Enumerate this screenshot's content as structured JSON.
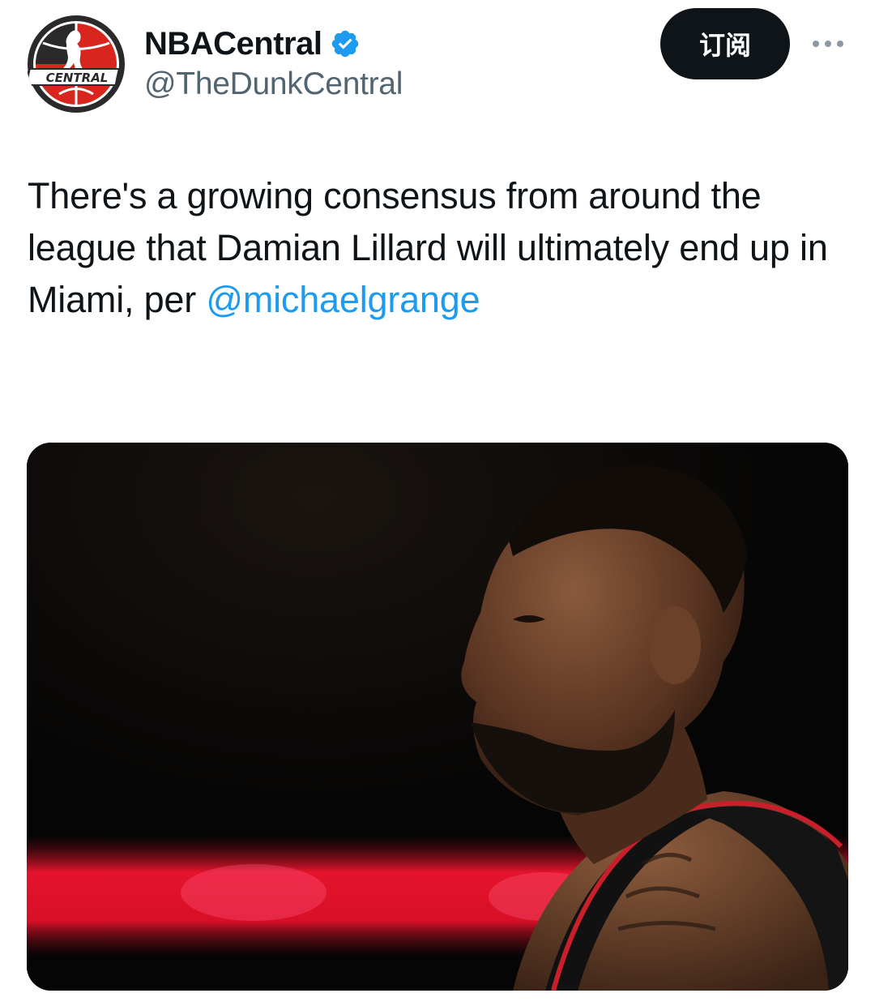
{
  "account": {
    "display_name": "NBACentral",
    "handle": "@TheDunkCentral",
    "avatar_text": "CENTRAL",
    "verified": true
  },
  "actions": {
    "subscribe_label": "订阅",
    "more_icon": "more-horizontal-icon"
  },
  "tweet": {
    "text_before": "There's a growing consensus from around the league that Damian Lillard will ultimately end up in Miami, per ",
    "mention": "@michaelgrange"
  },
  "media": {
    "icon": "photo-player-profile"
  },
  "colors": {
    "text_primary": "#0f1419",
    "text_secondary": "#536471",
    "link": "#1d9bf0",
    "verified": "#1d9bf0",
    "button_bg": "#0f1419"
  }
}
